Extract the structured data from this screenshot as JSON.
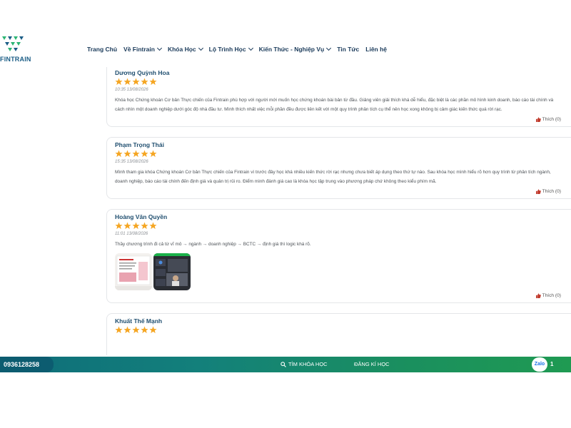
{
  "brand": {
    "logo_text": "FINTRAIN",
    "colors": {
      "primary": "#1b5d86",
      "green": "#2bb573",
      "star": "#f5a623"
    }
  },
  "nav": {
    "items": [
      {
        "label": "Trang Chủ",
        "dropdown": false
      },
      {
        "label": "Về Fintrain",
        "dropdown": true
      },
      {
        "label": "Khóa Học",
        "dropdown": true
      },
      {
        "label": "Lộ Trình Học",
        "dropdown": true
      },
      {
        "label": "Kiến Thức - Nghiệp Vụ",
        "dropdown": true
      },
      {
        "label": "Tin Tức",
        "dropdown": false
      },
      {
        "label": "Liên hệ",
        "dropdown": false
      }
    ]
  },
  "reviews": [
    {
      "name": "Dương Quỳnh Hoa",
      "rating": 5,
      "time": "10:35 13/08/2026",
      "text": "Khóa học Chứng khoán Cơ bản Thực chiến của Fintrain phù hợp với người mới muốn học chứng khoán bài bản từ đầu. Giảng viên giải thích khá dễ hiểu, đặc biệt là các phần mô hình kinh doanh, báo cáo tài chính và cách nhìn một doanh nghiệp dưới góc độ nhà đầu tư. Mình thích nhất việc mỗi phần đều được liên kết với một quy trình phân tích cụ thể nên học xong không bị cảm giác kiến thức quá rời rạc.",
      "like_label": "Thích (0)"
    },
    {
      "name": "Phạm Trọng Thái",
      "rating": 5,
      "time": "15:35 13/08/2026",
      "text": "Mình tham gia khóa Chứng khoán Cơ bản Thực chiến của Fintrain vì trước đây học khá nhiều kiến thức rời rạc nhưng chưa biết áp dụng theo thứ tự nào. Sau khóa học mình hiểu rõ hơn quy trình từ phân tích ngành, doanh nghiệp, báo cáo tài chính đến định giá và quản trị rủi ro. Điểm mình đánh giá cao là khóa học tập trung vào phương pháp chứ không theo kiểu phím mã.",
      "like_label": "Thích (0)"
    },
    {
      "name": "Hoàng Văn Quyền",
      "rating": 5,
      "time": "11:01 13/08/2026",
      "text": "Thầy chương trình đi cả từ vĩ mô → ngành → doanh nghiệp → BCTC → định giá thì logic khá rõ.",
      "like_label": "Thích (0)",
      "photos": [
        "slide-photo",
        "video-call-photo"
      ]
    },
    {
      "name": "Khuất Thế Mạnh",
      "rating": 5
    }
  ],
  "footer": {
    "phone": "0936128258",
    "search_label": "TÌM KHÓA HỌC",
    "register_label": "ĐĂNG KÍ HỌC",
    "zalo_label": "Zalo",
    "zalo_count": "1"
  }
}
